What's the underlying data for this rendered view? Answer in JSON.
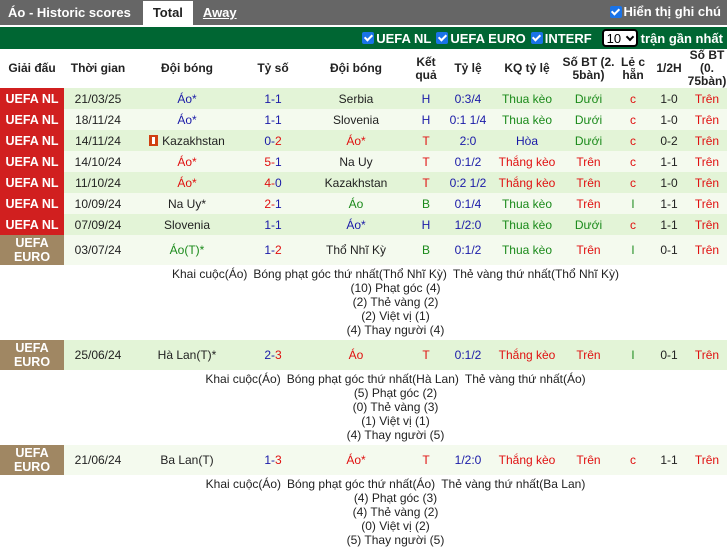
{
  "header": {
    "title": "Áo - Historic scores",
    "tabs": [
      {
        "label": "Total",
        "active": true
      },
      {
        "label": "Away",
        "active": false
      }
    ],
    "show_notes_label": "Hiển thị ghi chú",
    "show_notes_checked": true
  },
  "filters": {
    "items": [
      {
        "label": "UEFA NL",
        "checked": true
      },
      {
        "label": "UEFA EURO",
        "checked": true
      },
      {
        "label": "INTERF",
        "checked": true
      }
    ],
    "recent_count": "10",
    "recent_label": "trận gần nhất"
  },
  "columns": [
    "Giải đấu",
    "Thời gian",
    "Đội bóng",
    "Tỷ số",
    "Đội bóng",
    "Kết quả",
    "Tỷ lệ",
    "KQ tỷ lệ",
    "Số BT (2. 5bàn)",
    "Lẻ c hẵn",
    "1/2H",
    "Số BT (0. 75bàn)"
  ],
  "colors": {
    "uefa_nl": "#d11f1f",
    "uefa_euro": "#a08763",
    "header_bar": "#666666",
    "filter_bar": "#006633"
  },
  "matches": [
    {
      "league": "UEFA NL",
      "date": "21/03/25",
      "home": "Áo*",
      "home_color": "blue",
      "score_home": "1",
      "score_away": "1",
      "sh_color": "blue",
      "sa_color": "blue",
      "away": "Serbia",
      "away_color": "dark",
      "result": "H",
      "result_color": "blue",
      "odds": "0:3/4",
      "odds_result": "Thua kèo",
      "or_color": "green",
      "ou": "Dưới",
      "ou_color": "green",
      "oe": "c",
      "oe_color": "red",
      "ht": "1-0",
      "ou75": "Trên",
      "home_card": false
    },
    {
      "league": "UEFA NL",
      "date": "18/11/24",
      "home": "Áo*",
      "home_color": "blue",
      "score_home": "1",
      "score_away": "1",
      "sh_color": "blue",
      "sa_color": "blue",
      "away": "Slovenia",
      "away_color": "dark",
      "result": "H",
      "result_color": "blue",
      "odds": "0:1 1/4",
      "odds_result": "Thua kèo",
      "or_color": "green",
      "ou": "Dưới",
      "ou_color": "green",
      "oe": "c",
      "oe_color": "red",
      "ht": "1-0",
      "ou75": "Trên",
      "home_card": false
    },
    {
      "league": "UEFA NL",
      "date": "14/11/24",
      "home": "Kazakhstan",
      "home_color": "dark",
      "score_home": "0",
      "score_away": "2",
      "sh_color": "blue",
      "sa_color": "red",
      "away": "Áo*",
      "away_color": "red",
      "result": "T",
      "result_color": "red",
      "odds": "2:0",
      "odds_result": "Hòa",
      "or_color": "blue",
      "ou": "Dưới",
      "ou_color": "green",
      "oe": "c",
      "oe_color": "red",
      "ht": "0-2",
      "ou75": "Trên",
      "home_card": true
    },
    {
      "league": "UEFA NL",
      "date": "14/10/24",
      "home": "Áo*",
      "home_color": "red",
      "score_home": "5",
      "score_away": "1",
      "sh_color": "red",
      "sa_color": "blue",
      "away": "Na Uy",
      "away_color": "dark",
      "result": "T",
      "result_color": "red",
      "odds": "0:1/2",
      "odds_result": "Thắng kèo",
      "or_color": "red",
      "ou": "Trên",
      "ou_color": "red",
      "oe": "c",
      "oe_color": "red",
      "ht": "1-1",
      "ou75": "Trên",
      "home_card": false
    },
    {
      "league": "UEFA NL",
      "date": "11/10/24",
      "home": "Áo*",
      "home_color": "red",
      "score_home": "4",
      "score_away": "0",
      "sh_color": "red",
      "sa_color": "blue",
      "away": "Kazakhstan",
      "away_color": "dark",
      "result": "T",
      "result_color": "red",
      "odds": "0:2 1/2",
      "odds_result": "Thắng kèo",
      "or_color": "red",
      "ou": "Trên",
      "ou_color": "red",
      "oe": "c",
      "oe_color": "red",
      "ht": "1-0",
      "ou75": "Trên",
      "home_card": false
    },
    {
      "league": "UEFA NL",
      "date": "10/09/24",
      "home": "Na Uy*",
      "home_color": "dark",
      "score_home": "2",
      "score_away": "1",
      "sh_color": "red",
      "sa_color": "blue",
      "away": "Áo",
      "away_color": "green",
      "result": "B",
      "result_color": "green",
      "odds": "0:1/4",
      "odds_result": "Thua kèo",
      "or_color": "green",
      "ou": "Trên",
      "ou_color": "red",
      "oe": "l",
      "oe_color": "green",
      "ht": "1-1",
      "ou75": "Trên",
      "home_card": false
    },
    {
      "league": "UEFA NL",
      "date": "07/09/24",
      "home": "Slovenia",
      "home_color": "dark",
      "score_home": "1",
      "score_away": "1",
      "sh_color": "blue",
      "sa_color": "blue",
      "away": "Áo*",
      "away_color": "blue",
      "result": "H",
      "result_color": "blue",
      "odds": "1/2:0",
      "odds_result": "Thua kèo",
      "or_color": "green",
      "ou": "Dưới",
      "ou_color": "green",
      "oe": "c",
      "oe_color": "red",
      "ht": "1-1",
      "ou75": "Trên",
      "home_card": false
    },
    {
      "league": "UEFA EURO",
      "date": "03/07/24",
      "home": "Áo(T)*",
      "home_color": "green",
      "score_home": "1",
      "score_away": "2",
      "sh_color": "blue",
      "sa_color": "red",
      "away": "Thổ Nhĩ Kỳ",
      "away_color": "dark",
      "result": "B",
      "result_color": "green",
      "odds": "0:1/2",
      "odds_result": "Thua kèo",
      "or_color": "green",
      "ou": "Trên",
      "ou_color": "red",
      "oe": "l",
      "oe_color": "green",
      "ht": "0-1",
      "ou75": "Trên",
      "home_card": false,
      "details": {
        "kickoff": "Khai cuộc(Áo)",
        "first_corner": "Bóng phạt góc thứ nhất(Thổ Nhĩ Kỳ)",
        "first_yellow": "Thẻ vàng thứ nhất(Thổ Nhĩ Kỳ)",
        "corners": "(10) Phạt góc (4)",
        "yellows": "(2) Thẻ vàng (2)",
        "offsides": "(2) Việt vị (1)",
        "subs": "(4) Thay người (4)"
      }
    },
    {
      "league": "UEFA EURO",
      "date": "25/06/24",
      "home": "Hà Lan(T)*",
      "home_color": "dark",
      "score_home": "2",
      "score_away": "3",
      "sh_color": "blue",
      "sa_color": "red",
      "away": "Áo",
      "away_color": "red",
      "result": "T",
      "result_color": "red",
      "odds": "0:1/2",
      "odds_result": "Thắng kèo",
      "or_color": "red",
      "ou": "Trên",
      "ou_color": "red",
      "oe": "l",
      "oe_color": "green",
      "ht": "0-1",
      "ou75": "Trên",
      "home_card": false,
      "details": {
        "kickoff": "Khai cuộc(Áo)",
        "first_corner": "Bóng phạt góc thứ nhất(Hà Lan)",
        "first_yellow": "Thẻ vàng thứ nhất(Áo)",
        "corners": "(5) Phạt góc (2)",
        "yellows": "(0) Thẻ vàng (3)",
        "offsides": "(1) Việt vị (1)",
        "subs": "(4) Thay người (5)"
      }
    },
    {
      "league": "UEFA EURO",
      "date": "21/06/24",
      "home": "Ba Lan(T)",
      "home_color": "dark",
      "score_home": "1",
      "score_away": "3",
      "sh_color": "blue",
      "sa_color": "red",
      "away": "Áo*",
      "away_color": "red",
      "result": "T",
      "result_color": "red",
      "odds": "1/2:0",
      "odds_result": "Thắng kèo",
      "or_color": "red",
      "ou": "Trên",
      "ou_color": "red",
      "oe": "c",
      "oe_color": "red",
      "ht": "1-1",
      "ou75": "Trên",
      "home_card": false,
      "details": {
        "kickoff": "Khai cuộc(Áo)",
        "first_corner": "Bóng phạt góc thứ nhất(Áo)",
        "first_yellow": "Thẻ vàng thứ nhất(Ba Lan)",
        "corners": "(4) Phạt góc (3)",
        "yellows": "(4) Thẻ vàng (2)",
        "offsides": "(0) Việt vị (2)",
        "subs": "(5) Thay người (5)"
      }
    }
  ]
}
